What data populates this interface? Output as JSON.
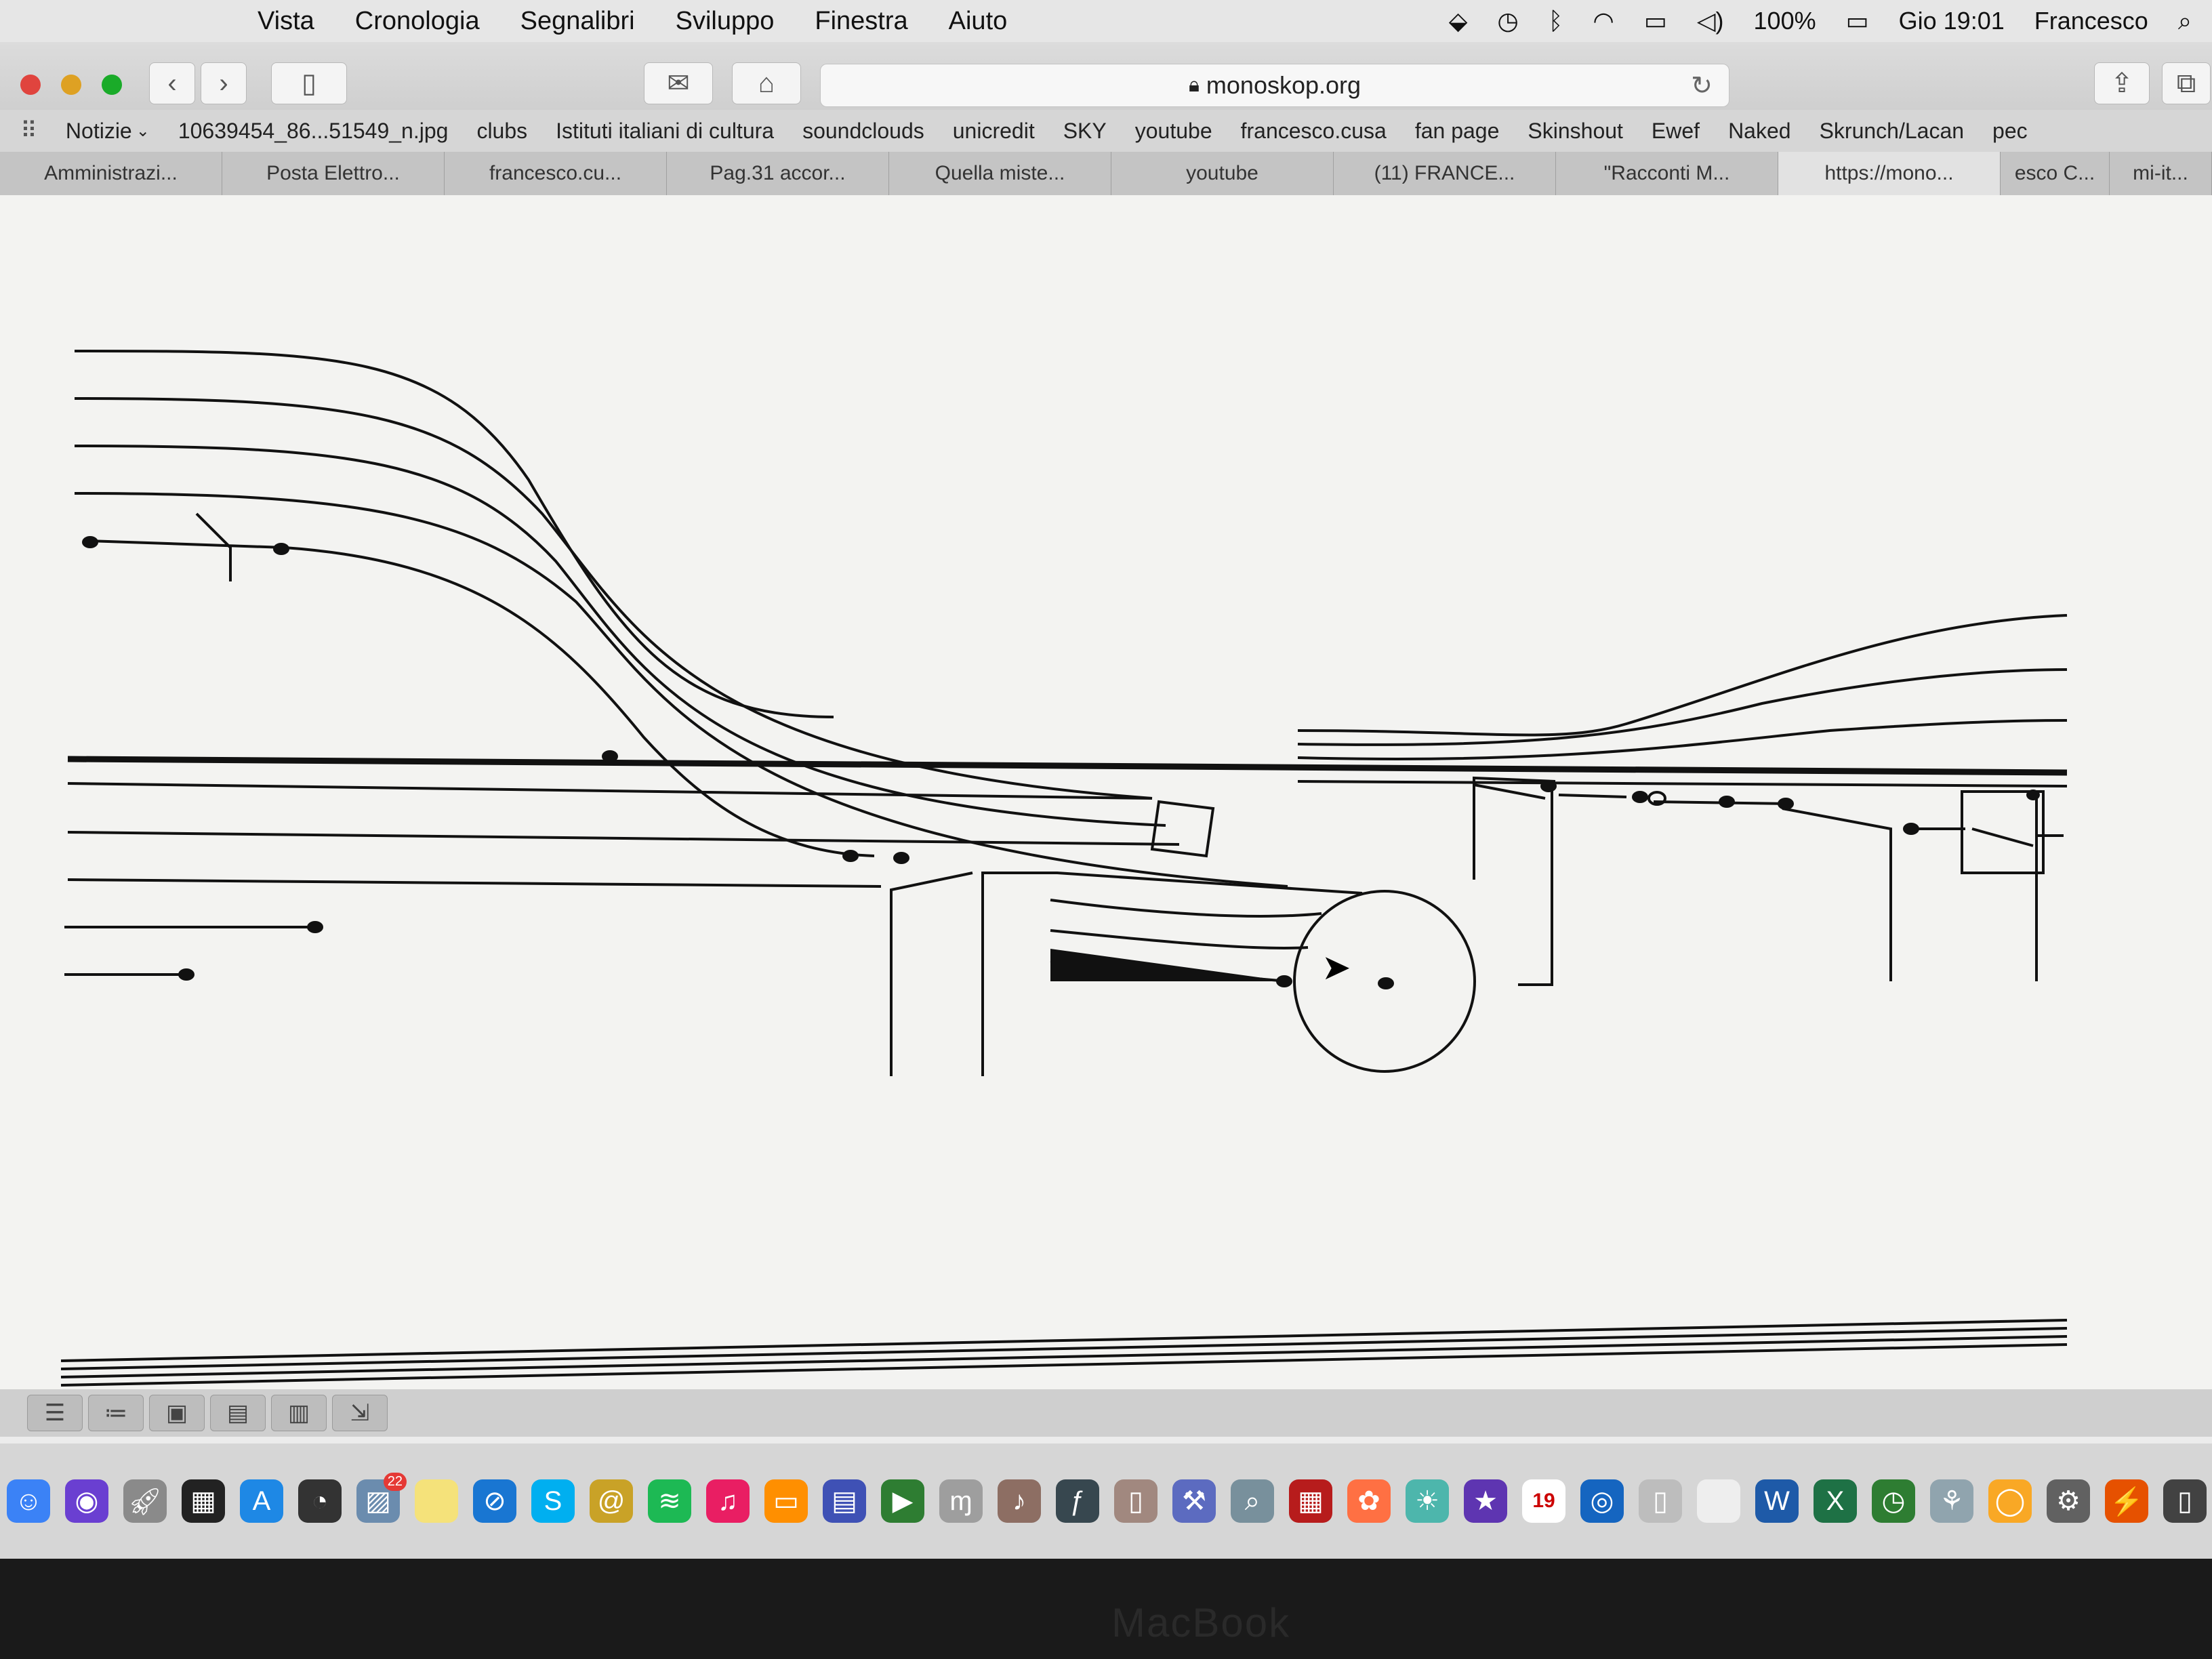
{
  "menubar": {
    "items": [
      "Vista",
      "Cronologia",
      "Segnalibri",
      "Sviluppo",
      "Finestra",
      "Aiuto"
    ],
    "battery": "100%",
    "clock": "Gio 19:01",
    "user": "Francesco"
  },
  "toolbar": {
    "url": "monoskop.org"
  },
  "bookmarks": {
    "items": [
      "Notizie",
      "10639454_86...51549_n.jpg",
      "clubs",
      "Istituti italiani di cultura",
      "soundclouds",
      "unicredit",
      "SKY",
      "youtube",
      "francesco.cusa",
      "fan page",
      "Skinshout",
      "Ewef",
      "Naked",
      "Skrunch/Lacan",
      "pec"
    ]
  },
  "tabs": [
    "Amministrazi...",
    "Posta Elettro...",
    "francesco.cu...",
    "Pag.31 accor...",
    "Quella miste...",
    "youtube",
    "(11) FRANCE...",
    "\"Racconti M...",
    "https://mono...",
    "esco C...",
    "mi-it..."
  ],
  "dock": {
    "calendar_day": "19",
    "badge_count": "22"
  },
  "bezel": "MacBook"
}
